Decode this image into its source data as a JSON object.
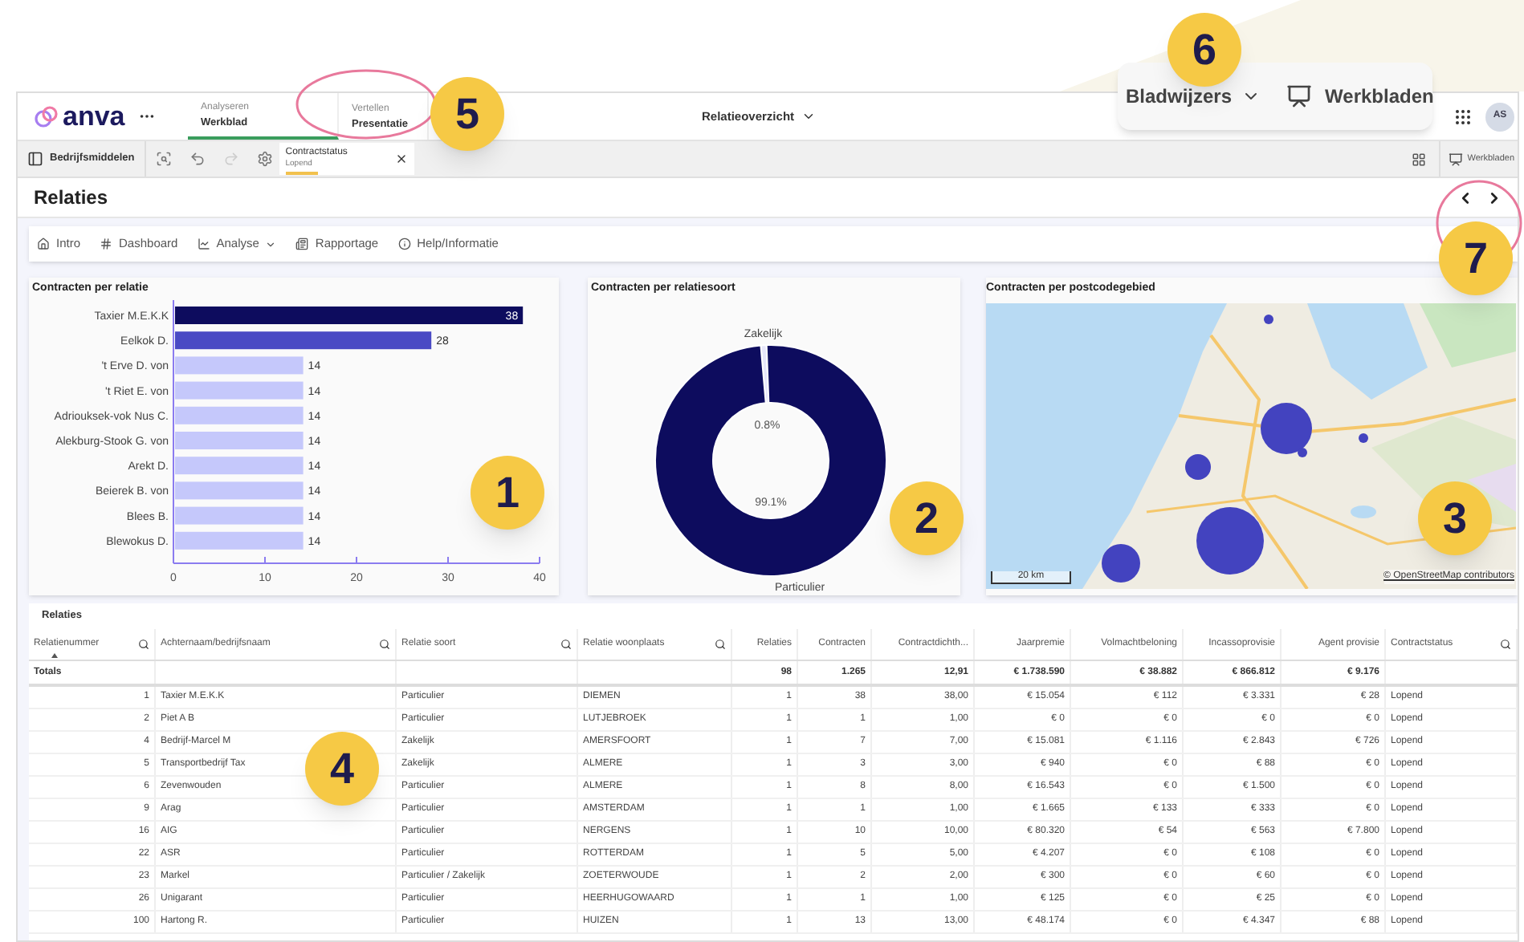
{
  "app": {
    "logo": "anva"
  },
  "tabs": [
    {
      "top": "Analyseren",
      "label": "Werkblad",
      "selected": true
    },
    {
      "top": "Vertellen",
      "label": "Presentatie",
      "selected": false
    }
  ],
  "sheet_menu": "Relatieoverzicht",
  "avatar": "AS",
  "toolbar": {
    "assets": "Bedrijfsmiddelen",
    "filter": {
      "field": "Contractstatus",
      "value": "Lopend"
    },
    "sheets": "Werkbladen"
  },
  "page_title": "Relaties",
  "nav": [
    {
      "label": "Intro",
      "kind": "home",
      "dropdown": false
    },
    {
      "label": "Dashboard",
      "kind": "hash",
      "dropdown": false
    },
    {
      "label": "Analyse",
      "kind": "chart",
      "dropdown": true
    },
    {
      "label": "Rapportage",
      "kind": "report",
      "dropdown": false
    },
    {
      "label": "Help/Informatie",
      "kind": "info",
      "dropdown": false
    }
  ],
  "bar_panel": {
    "chart_data": {
      "type": "bar",
      "orientation": "horizontal",
      "title": "Contracten per relatie",
      "categories": [
        "Taxier M.E.K.K",
        "Eelkok D.",
        "'t Erve D. von",
        "'t Riet E. von",
        "Adriouksek-vok Nus C.",
        "Alekburg-Stook G. von",
        "Arekt D.",
        "Beierek B. von",
        "Blees B.",
        "Blewokus D."
      ],
      "values": [
        38,
        28,
        14,
        14,
        14,
        14,
        14,
        14,
        14,
        14
      ],
      "colors": [
        "#0d0c5e",
        "#4a4ac4",
        "#c5c8fb",
        "#c5c8fb",
        "#c5c8fb",
        "#c5c8fb",
        "#c5c8fb",
        "#c5c8fb",
        "#c5c8fb",
        "#c5c8fb"
      ],
      "xlim": [
        0,
        40
      ],
      "xticks": [
        0,
        10,
        20,
        30,
        40
      ],
      "data_labels": true
    }
  },
  "donut_panel": {
    "chart_data": {
      "type": "donut",
      "title": "Contracten per relatiesoort",
      "categories": [
        "Zakelijk",
        "Particulier"
      ],
      "values": [
        0.8,
        99.1
      ],
      "colors": [
        "#e6e6fa",
        "#0d0c5e"
      ],
      "value_labels": [
        "0.8%",
        "99.1%"
      ]
    }
  },
  "map_panel": {
    "title": "Contracten per postcodegebied",
    "scale": "20 km",
    "attribution": "© OpenStreetMap contributors"
  },
  "table": {
    "title": "Relaties",
    "columns": [
      {
        "label": "Relatienummer",
        "search": true,
        "sorted": true
      },
      {
        "label": "Achternaam/bedrijfsnaam",
        "search": true,
        "sorted": false
      },
      {
        "label": "Relatie soort",
        "search": true,
        "sorted": false
      },
      {
        "label": "Relatie woonplaats",
        "search": true,
        "sorted": false
      },
      {
        "label": "Relaties",
        "search": false,
        "sorted": false
      },
      {
        "label": "Contracten",
        "search": false,
        "sorted": false
      },
      {
        "label": "Contractdichth...",
        "search": false,
        "sorted": false
      },
      {
        "label": "Jaarpremie",
        "search": false,
        "sorted": false
      },
      {
        "label": "Volmachtbeloning",
        "search": false,
        "sorted": false
      },
      {
        "label": "Incassoprovisie",
        "search": false,
        "sorted": false
      },
      {
        "label": "Agent provisie",
        "search": false,
        "sorted": false
      },
      {
        "label": "Contractstatus",
        "search": true,
        "sorted": false
      }
    ],
    "totals_label": "Totals",
    "totals": [
      "98",
      "1.265",
      "12,91",
      "€ 1.738.590",
      "€ 38.882",
      "€ 866.812",
      "€ 9.176"
    ],
    "rows": [
      [
        "1",
        "Taxier M.E.K.K",
        "Particulier",
        "DIEMEN",
        "1",
        "38",
        "38,00",
        "€ 15.054",
        "€ 112",
        "€ 3.331",
        "€ 28",
        "Lopend"
      ],
      [
        "2",
        "Piet A B",
        "Particulier",
        "LUTJEBROEK",
        "1",
        "1",
        "1,00",
        "€ 0",
        "€ 0",
        "€ 0",
        "€ 0",
        "Lopend"
      ],
      [
        "4",
        "Bedrijf-Marcel M",
        "Zakelijk",
        "AMERSFOORT",
        "1",
        "7",
        "7,00",
        "€ 15.081",
        "€ 1.116",
        "€ 2.843",
        "€ 726",
        "Lopend"
      ],
      [
        "5",
        "Transportbedrijf Tax",
        "Zakelijk",
        "ALMERE",
        "1",
        "3",
        "3,00",
        "€ 940",
        "€ 0",
        "€ 88",
        "€ 0",
        "Lopend"
      ],
      [
        "6",
        "Zevenwouden",
        "Particulier",
        "ALMERE",
        "1",
        "8",
        "8,00",
        "€ 16.543",
        "€ 0",
        "€ 1.500",
        "€ 0",
        "Lopend"
      ],
      [
        "9",
        "Arag",
        "Particulier",
        "AMSTERDAM",
        "1",
        "1",
        "1,00",
        "€ 1.665",
        "€ 133",
        "€ 333",
        "€ 0",
        "Lopend"
      ],
      [
        "16",
        "AIG",
        "Particulier",
        "NERGENS",
        "1",
        "10",
        "10,00",
        "€ 80.320",
        "€ 54",
        "€ 563",
        "€ 7.800",
        "Lopend"
      ],
      [
        "22",
        "ASR",
        "Particulier",
        "ROTTERDAM",
        "1",
        "5",
        "5,00",
        "€ 4.207",
        "€ 0",
        "€ 108",
        "€ 0",
        "Lopend"
      ],
      [
        "23",
        "Markel",
        "Particulier / Zakelijk",
        "ZOETERWOUDE",
        "1",
        "2",
        "2,00",
        "€ 300",
        "€ 0",
        "€ 60",
        "€ 0",
        "Lopend"
      ],
      [
        "26",
        "Unigarant",
        "Particulier",
        "HEERHUGOWAARD",
        "1",
        "1",
        "1,00",
        "€ 125",
        "€ 0",
        "€ 25",
        "€ 0",
        "Lopend"
      ],
      [
        "100",
        "Hartong R.",
        "Particulier",
        "HUIZEN",
        "1",
        "13",
        "13,00",
        "€ 48.174",
        "€ 0",
        "€ 4.347",
        "€ 88",
        "Lopend"
      ]
    ]
  },
  "popup": {
    "bookmarks": "Bladwijzers",
    "sheets": "Werkbladen"
  },
  "callouts": [
    "1",
    "2",
    "3",
    "4",
    "5",
    "6",
    "7"
  ]
}
